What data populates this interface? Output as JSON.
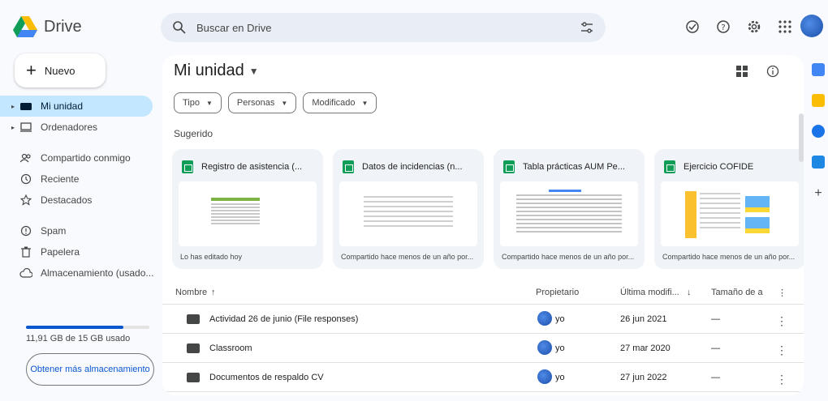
{
  "app": {
    "name": "Drive"
  },
  "search": {
    "placeholder": "Buscar en Drive"
  },
  "sidebar": {
    "new_label": "Nuevo",
    "items": [
      {
        "label": "Mi unidad",
        "icon": "drive-icon",
        "active": true
      },
      {
        "label": "Ordenadores",
        "icon": "computer-icon"
      },
      {
        "label": "Compartido conmigo",
        "icon": "shared-icon"
      },
      {
        "label": "Reciente",
        "icon": "clock-icon"
      },
      {
        "label": "Destacados",
        "icon": "star-icon"
      },
      {
        "label": "Spam",
        "icon": "spam-icon"
      },
      {
        "label": "Papelera",
        "icon": "trash-icon"
      },
      {
        "label": "Almacenamiento (usado...",
        "icon": "cloud-icon"
      }
    ],
    "storage_text": "11,91 GB de 15 GB usado",
    "storage_fraction": 0.79,
    "more_storage_label": "Obtener más almacenamiento"
  },
  "main": {
    "title": "Mi unidad",
    "chips": [
      "Tipo",
      "Personas",
      "Modificado"
    ],
    "suggested_label": "Sugerido",
    "cards": [
      {
        "title": "Registro de asistencia (...",
        "foot": "Lo has editado hoy"
      },
      {
        "title": "Datos de incidencias (n...",
        "foot": "Compartido hace menos de un año por..."
      },
      {
        "title": "Tabla prácticas AUM Pe...",
        "foot": "Compartido hace menos de un año por..."
      },
      {
        "title": "Ejercicio COFIDE",
        "foot": "Compartido hace menos de un año por..."
      }
    ],
    "columns": {
      "name": "Nombre",
      "owner": "Propietario",
      "modified": "Última modifi...",
      "size": "Tamaño de a"
    },
    "rows": [
      {
        "name": "Actividad 26 de junio (File responses)",
        "owner": "yo",
        "modified": "26 jun 2021",
        "size": "—"
      },
      {
        "name": "Classroom",
        "owner": "yo",
        "modified": "27 mar 2020",
        "size": "—"
      },
      {
        "name": "Documentos de respaldo CV",
        "owner": "yo",
        "modified": "27 jun 2022",
        "size": "—"
      }
    ]
  },
  "colors": {
    "accent": "#0b57d0",
    "active_nav": "#c2e7ff",
    "sheets": "#0f9d58"
  }
}
